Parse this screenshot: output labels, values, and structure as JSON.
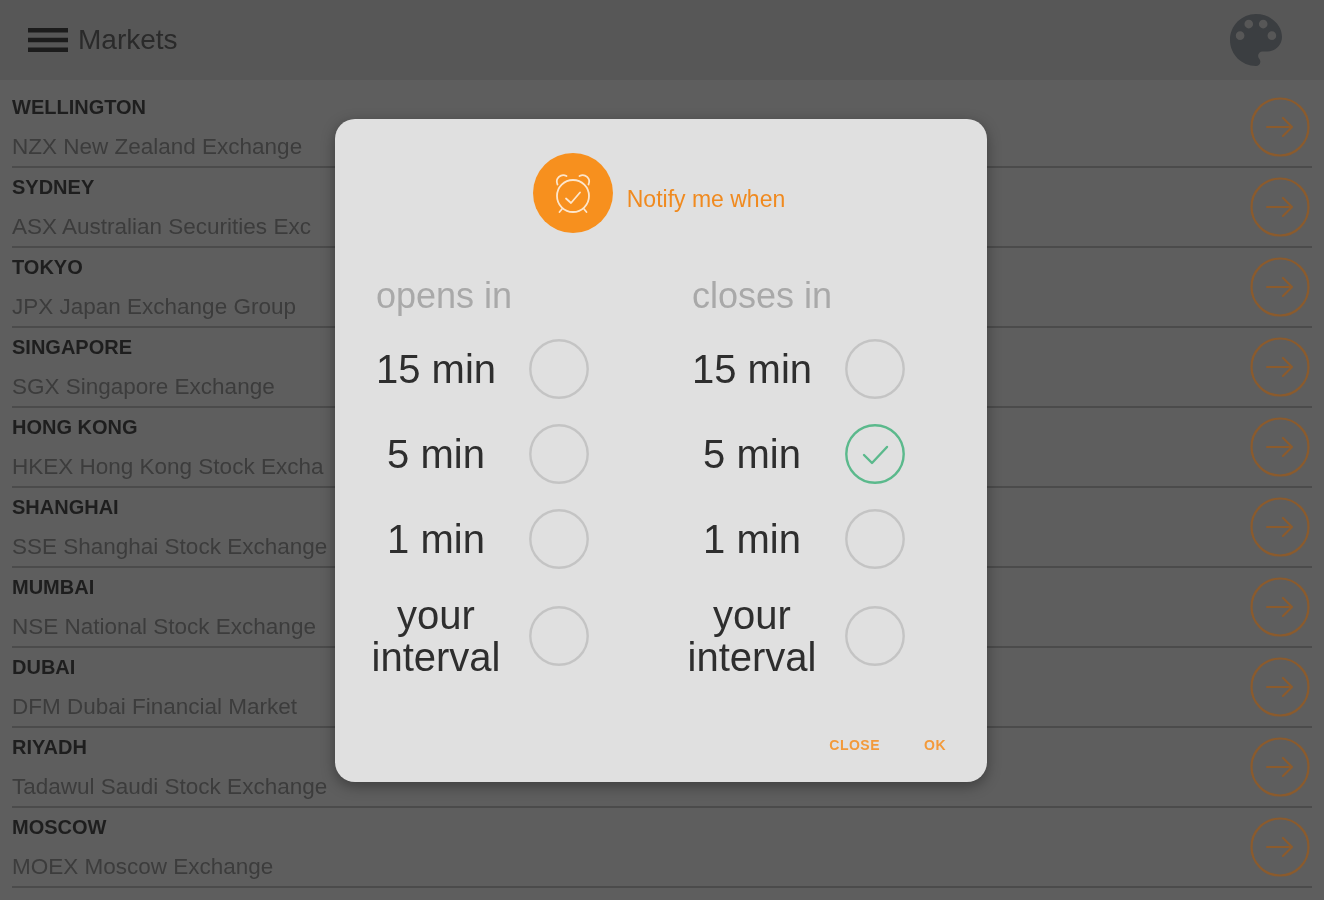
{
  "app_bar": {
    "title": "Markets"
  },
  "markets": [
    {
      "city": "WELLINGTON",
      "exchange": "NZX New Zealand Exchange"
    },
    {
      "city": "SYDNEY",
      "exchange": "ASX Australian Securities Exc"
    },
    {
      "city": "TOKYO",
      "exchange": "JPX Japan Exchange Group"
    },
    {
      "city": "SINGAPORE",
      "exchange": "SGX Singapore Exchange"
    },
    {
      "city": "HONG KONG",
      "exchange": "HKEX Hong Kong Stock Excha"
    },
    {
      "city": "SHANGHAI",
      "exchange": "SSE Shanghai Stock Exchange"
    },
    {
      "city": "MUMBAI",
      "exchange": "NSE National Stock Exchange"
    },
    {
      "city": "DUBAI",
      "exchange": "DFM Dubai Financial Market"
    },
    {
      "city": "RIYADH",
      "exchange": "Tadawul Saudi Stock Exchange"
    },
    {
      "city": "MOSCOW",
      "exchange": "MOEX Moscow Exchange"
    }
  ],
  "dialog": {
    "title": "Notify me when",
    "columns": [
      {
        "heading": "opens in",
        "options": [
          {
            "label": "15 min",
            "selected": false
          },
          {
            "label": "5 min",
            "selected": false
          },
          {
            "label": "1 min",
            "selected": false
          },
          {
            "label": "your interval",
            "selected": false
          }
        ]
      },
      {
        "heading": "closes in",
        "options": [
          {
            "label": "15 min",
            "selected": false
          },
          {
            "label": "5 min",
            "selected": true
          },
          {
            "label": "1 min",
            "selected": false
          },
          {
            "label": "your interval",
            "selected": false
          }
        ]
      }
    ],
    "buttons": [
      "CLOSE",
      "OK"
    ]
  }
}
